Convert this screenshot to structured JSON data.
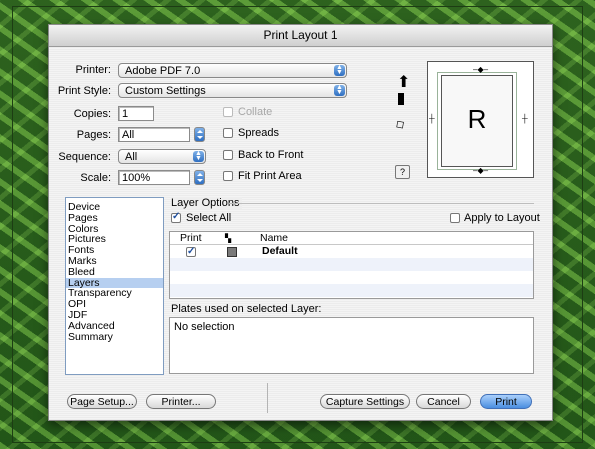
{
  "window": {
    "title": "Print Layout 1"
  },
  "printer": {
    "label": "Printer:",
    "value": "Adobe PDF 7.0"
  },
  "print_style": {
    "label": "Print Style:",
    "value": "Custom Settings"
  },
  "copies": {
    "label": "Copies:",
    "value": "1"
  },
  "pages": {
    "label": "Pages:",
    "value": "All"
  },
  "sequence": {
    "label": "Sequence:",
    "value": "All"
  },
  "scale": {
    "label": "Scale:",
    "value": "100%"
  },
  "options": {
    "collate": "Collate",
    "spreads": "Spreads",
    "back_to_front": "Back to Front",
    "fit_print_area": "Fit Print Area"
  },
  "preview": {
    "letter": "R",
    "help": "?"
  },
  "categories": [
    "Device",
    "Pages",
    "Colors",
    "Pictures",
    "Fonts",
    "Marks",
    "Bleed",
    "Layers",
    "Transparency",
    "OPI",
    "JDF",
    "Advanced",
    "Summary"
  ],
  "selected_category": "Layers",
  "layer_options": {
    "title": "Layer Options",
    "select_all": "Select All",
    "apply_to_layout": "Apply to Layout",
    "columns": {
      "print": "Print",
      "name": "Name"
    },
    "rows": [
      {
        "print": true,
        "name": "Default"
      }
    ]
  },
  "plates": {
    "label": "Plates used on selected Layer:",
    "value": "No selection"
  },
  "buttons": {
    "page_setup": "Page Setup...",
    "printer": "Printer...",
    "capture_settings": "Capture Settings",
    "cancel": "Cancel",
    "print": "Print"
  }
}
